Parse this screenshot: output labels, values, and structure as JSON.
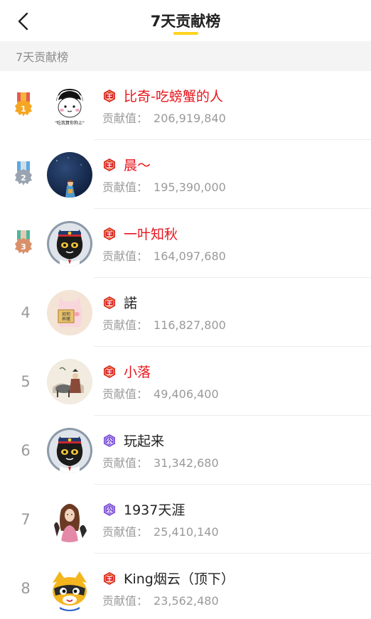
{
  "header": {
    "title": "7天贡献榜"
  },
  "section": {
    "label": "7天贡献榜"
  },
  "score_label": "贡献值：",
  "colors": {
    "accent_yellow": "#ffd21e",
    "vip_red": "#e8141c",
    "badge_red": "#d9232d",
    "badge_purple": "#7b4fd6"
  },
  "entries": [
    {
      "rank": "1",
      "medal": "gold",
      "badge": "王",
      "badge_icon": "king-badge-icon",
      "name": "比奇-吃螃蟹的人",
      "name_red": true,
      "score": "206,919,840",
      "avatar_caption": "\"吃我算你狗上\""
    },
    {
      "rank": "2",
      "medal": "silver",
      "badge": "王",
      "badge_icon": "king-badge-icon",
      "name": "晨～",
      "name_red": true,
      "score": "195,390,000"
    },
    {
      "rank": "3",
      "medal": "bronze",
      "badge": "王",
      "badge_icon": "king-badge-icon",
      "name": "一叶知秋",
      "name_red": true,
      "score": "164,097,680"
    },
    {
      "rank": "4",
      "badge": "王",
      "badge_icon": "king-badge-icon",
      "name": "諾",
      "name_red": false,
      "score": "116,827,800",
      "avatar_text": "如何养猪"
    },
    {
      "rank": "5",
      "badge": "王",
      "badge_icon": "king-badge-icon",
      "name": "小落",
      "name_red": true,
      "score": "49,406,400"
    },
    {
      "rank": "6",
      "badge": "公",
      "badge_icon": "duke-badge-icon",
      "name": "玩起来",
      "name_red": false,
      "score": "31,342,680"
    },
    {
      "rank": "7",
      "badge": "公",
      "badge_icon": "duke-badge-icon",
      "name": "1937天涯",
      "name_red": false,
      "score": "25,410,140"
    },
    {
      "rank": "8",
      "badge": "王",
      "badge_icon": "king-badge-icon",
      "name": "King烟云（顶下）",
      "name_red": false,
      "score": "23,562,480"
    }
  ]
}
